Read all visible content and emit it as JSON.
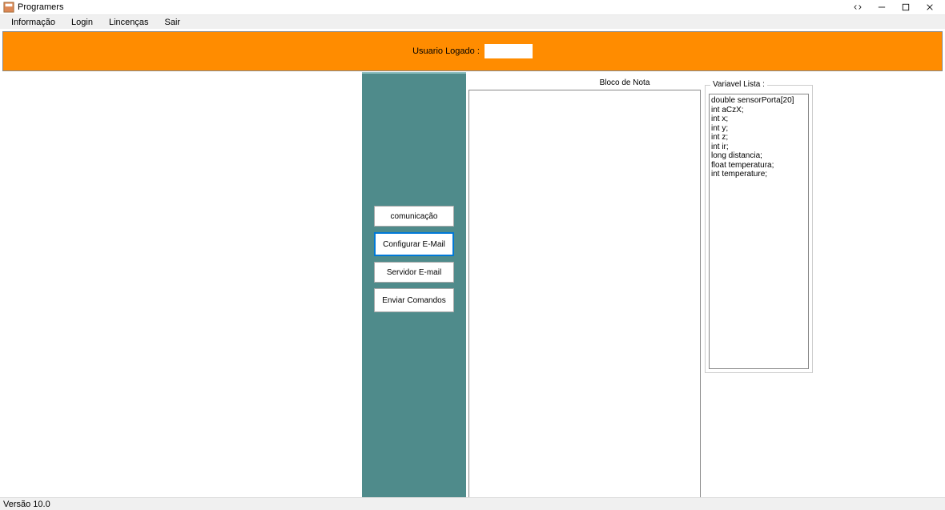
{
  "window": {
    "title": "Programers"
  },
  "menu": {
    "items": [
      "Informação",
      "Login",
      "Lincenças",
      "Sair"
    ]
  },
  "header": {
    "user_label": "Usuario Logado :",
    "user_value": ""
  },
  "sidebar": {
    "buttons": [
      {
        "label": "comunicação",
        "active": false
      },
      {
        "label": "Configurar E-Mail",
        "active": true
      },
      {
        "label": "Servidor E-mail",
        "active": false
      },
      {
        "label": "Enviar Comandos",
        "active": false
      }
    ]
  },
  "notepad": {
    "title": "Bloco de Nota",
    "content": ""
  },
  "variables": {
    "title": "Variavel Lista :",
    "lines": [
      "double sensorPorta[20]",
      "int aCzX;",
      "int x;",
      "int y;",
      "int z;",
      "int ir;",
      "long distancia;",
      "float temperatura;",
      "int temperature;"
    ]
  },
  "status": {
    "version": "Versão 10.0"
  }
}
